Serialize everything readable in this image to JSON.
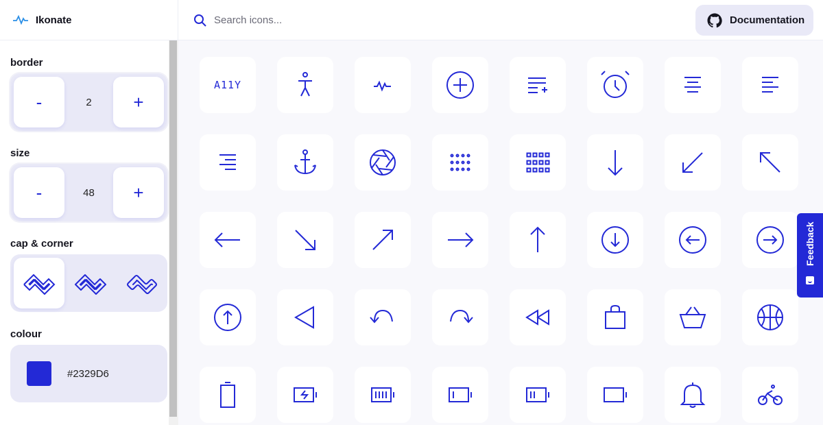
{
  "brand": {
    "name": "Ikonate",
    "logo_icon": "activity-icon"
  },
  "search": {
    "placeholder": "Search icons..."
  },
  "docs": {
    "label": "Documentation",
    "icon": "github-icon"
  },
  "controls": {
    "border": {
      "label": "border",
      "value": "2",
      "minus": "-",
      "plus": "+"
    },
    "size": {
      "label": "size",
      "value": "48",
      "minus": "-",
      "plus": "+"
    },
    "caps": {
      "label": "cap & corner",
      "options": [
        "square-cap-option",
        "round-cap-option",
        "rounded-corner-option"
      ],
      "selected": 0
    },
    "colour": {
      "label": "colour",
      "value": "#2329D6"
    }
  },
  "feedback": {
    "label": "Feedback"
  },
  "colors": {
    "accent": "#2329D6",
    "panel": "#e9e9f7",
    "canvas": "#f8f8fc"
  },
  "icons": [
    {
      "name": "a11y",
      "text": "A11Y"
    },
    {
      "name": "accessibility-icon"
    },
    {
      "name": "activity-icon"
    },
    {
      "name": "add-circle-icon"
    },
    {
      "name": "add-to-list-icon"
    },
    {
      "name": "alarm-icon"
    },
    {
      "name": "align-center-icon"
    },
    {
      "name": "align-left-icon"
    },
    {
      "name": "align-right-icon"
    },
    {
      "name": "anchor-icon"
    },
    {
      "name": "aperture-icon"
    },
    {
      "name": "apps-alt-icon"
    },
    {
      "name": "apps-icon"
    },
    {
      "name": "arrow-down-icon"
    },
    {
      "name": "arrow-down-left-icon"
    },
    {
      "name": "arrow-up-left-icon"
    },
    {
      "name": "arrow-left-icon"
    },
    {
      "name": "arrow-down-right-icon"
    },
    {
      "name": "arrow-up-right-icon"
    },
    {
      "name": "arrow-right-icon"
    },
    {
      "name": "arrow-up-icon"
    },
    {
      "name": "arrow-down-circle-icon"
    },
    {
      "name": "arrow-left-circle-icon"
    },
    {
      "name": "arrow-right-circle-icon"
    },
    {
      "name": "arrow-up-circle-icon"
    },
    {
      "name": "back-icon"
    },
    {
      "name": "back-alt-icon"
    },
    {
      "name": "forward-alt-icon"
    },
    {
      "name": "rewind-icon"
    },
    {
      "name": "bag-icon"
    },
    {
      "name": "basket-icon"
    },
    {
      "name": "basketball-icon"
    },
    {
      "name": "battery-empty-icon"
    },
    {
      "name": "battery-charging-icon"
    },
    {
      "name": "battery-full-icon"
    },
    {
      "name": "battery-low-icon"
    },
    {
      "name": "battery-medium-icon"
    },
    {
      "name": "battery-icon"
    },
    {
      "name": "bell-icon"
    },
    {
      "name": "bike-icon"
    }
  ]
}
